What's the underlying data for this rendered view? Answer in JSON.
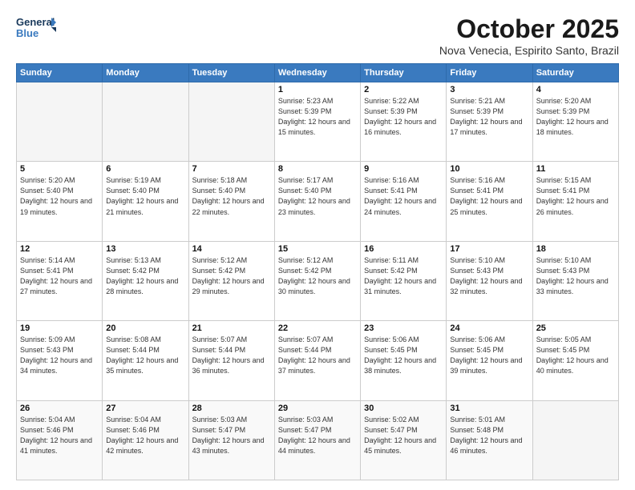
{
  "logo": {
    "line1": "General",
    "line2": "Blue"
  },
  "title": "October 2025",
  "subtitle": "Nova Venecia, Espirito Santo, Brazil",
  "weekdays": [
    "Sunday",
    "Monday",
    "Tuesday",
    "Wednesday",
    "Thursday",
    "Friday",
    "Saturday"
  ],
  "weeks": [
    [
      {
        "day": "",
        "info": ""
      },
      {
        "day": "",
        "info": ""
      },
      {
        "day": "",
        "info": ""
      },
      {
        "day": "1",
        "info": "Sunrise: 5:23 AM\nSunset: 5:39 PM\nDaylight: 12 hours\nand 15 minutes."
      },
      {
        "day": "2",
        "info": "Sunrise: 5:22 AM\nSunset: 5:39 PM\nDaylight: 12 hours\nand 16 minutes."
      },
      {
        "day": "3",
        "info": "Sunrise: 5:21 AM\nSunset: 5:39 PM\nDaylight: 12 hours\nand 17 minutes."
      },
      {
        "day": "4",
        "info": "Sunrise: 5:20 AM\nSunset: 5:39 PM\nDaylight: 12 hours\nand 18 minutes."
      }
    ],
    [
      {
        "day": "5",
        "info": "Sunrise: 5:20 AM\nSunset: 5:40 PM\nDaylight: 12 hours\nand 19 minutes."
      },
      {
        "day": "6",
        "info": "Sunrise: 5:19 AM\nSunset: 5:40 PM\nDaylight: 12 hours\nand 21 minutes."
      },
      {
        "day": "7",
        "info": "Sunrise: 5:18 AM\nSunset: 5:40 PM\nDaylight: 12 hours\nand 22 minutes."
      },
      {
        "day": "8",
        "info": "Sunrise: 5:17 AM\nSunset: 5:40 PM\nDaylight: 12 hours\nand 23 minutes."
      },
      {
        "day": "9",
        "info": "Sunrise: 5:16 AM\nSunset: 5:41 PM\nDaylight: 12 hours\nand 24 minutes."
      },
      {
        "day": "10",
        "info": "Sunrise: 5:16 AM\nSunset: 5:41 PM\nDaylight: 12 hours\nand 25 minutes."
      },
      {
        "day": "11",
        "info": "Sunrise: 5:15 AM\nSunset: 5:41 PM\nDaylight: 12 hours\nand 26 minutes."
      }
    ],
    [
      {
        "day": "12",
        "info": "Sunrise: 5:14 AM\nSunset: 5:41 PM\nDaylight: 12 hours\nand 27 minutes."
      },
      {
        "day": "13",
        "info": "Sunrise: 5:13 AM\nSunset: 5:42 PM\nDaylight: 12 hours\nand 28 minutes."
      },
      {
        "day": "14",
        "info": "Sunrise: 5:12 AM\nSunset: 5:42 PM\nDaylight: 12 hours\nand 29 minutes."
      },
      {
        "day": "15",
        "info": "Sunrise: 5:12 AM\nSunset: 5:42 PM\nDaylight: 12 hours\nand 30 minutes."
      },
      {
        "day": "16",
        "info": "Sunrise: 5:11 AM\nSunset: 5:42 PM\nDaylight: 12 hours\nand 31 minutes."
      },
      {
        "day": "17",
        "info": "Sunrise: 5:10 AM\nSunset: 5:43 PM\nDaylight: 12 hours\nand 32 minutes."
      },
      {
        "day": "18",
        "info": "Sunrise: 5:10 AM\nSunset: 5:43 PM\nDaylight: 12 hours\nand 33 minutes."
      }
    ],
    [
      {
        "day": "19",
        "info": "Sunrise: 5:09 AM\nSunset: 5:43 PM\nDaylight: 12 hours\nand 34 minutes."
      },
      {
        "day": "20",
        "info": "Sunrise: 5:08 AM\nSunset: 5:44 PM\nDaylight: 12 hours\nand 35 minutes."
      },
      {
        "day": "21",
        "info": "Sunrise: 5:07 AM\nSunset: 5:44 PM\nDaylight: 12 hours\nand 36 minutes."
      },
      {
        "day": "22",
        "info": "Sunrise: 5:07 AM\nSunset: 5:44 PM\nDaylight: 12 hours\nand 37 minutes."
      },
      {
        "day": "23",
        "info": "Sunrise: 5:06 AM\nSunset: 5:45 PM\nDaylight: 12 hours\nand 38 minutes."
      },
      {
        "day": "24",
        "info": "Sunrise: 5:06 AM\nSunset: 5:45 PM\nDaylight: 12 hours\nand 39 minutes."
      },
      {
        "day": "25",
        "info": "Sunrise: 5:05 AM\nSunset: 5:45 PM\nDaylight: 12 hours\nand 40 minutes."
      }
    ],
    [
      {
        "day": "26",
        "info": "Sunrise: 5:04 AM\nSunset: 5:46 PM\nDaylight: 12 hours\nand 41 minutes."
      },
      {
        "day": "27",
        "info": "Sunrise: 5:04 AM\nSunset: 5:46 PM\nDaylight: 12 hours\nand 42 minutes."
      },
      {
        "day": "28",
        "info": "Sunrise: 5:03 AM\nSunset: 5:47 PM\nDaylight: 12 hours\nand 43 minutes."
      },
      {
        "day": "29",
        "info": "Sunrise: 5:03 AM\nSunset: 5:47 PM\nDaylight: 12 hours\nand 44 minutes."
      },
      {
        "day": "30",
        "info": "Sunrise: 5:02 AM\nSunset: 5:47 PM\nDaylight: 12 hours\nand 45 minutes."
      },
      {
        "day": "31",
        "info": "Sunrise: 5:01 AM\nSunset: 5:48 PM\nDaylight: 12 hours\nand 46 minutes."
      },
      {
        "day": "",
        "info": ""
      }
    ]
  ]
}
